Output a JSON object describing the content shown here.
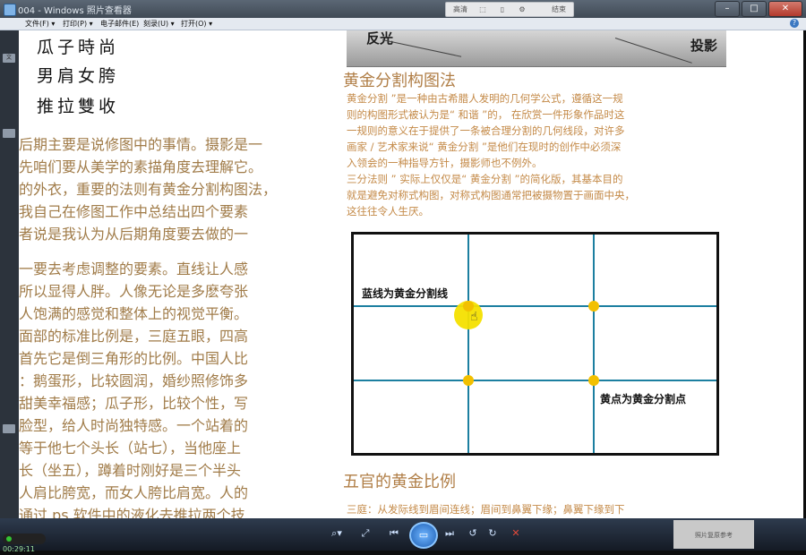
{
  "window": {
    "title": "004 - Windows 照片查看器",
    "recorder": [
      "高清",
      "结束"
    ],
    "buttons": [
      "–",
      "□",
      "✕"
    ]
  },
  "menu": {
    "items": [
      "文件(F) ▾",
      "打印(P) ▾",
      "电子邮件(E)",
      "刻录(U) ▾",
      "打开(O) ▾"
    ],
    "help_icon": "?"
  },
  "left_strip": {
    "tab_label": "文"
  },
  "timer": {
    "text": "00:29:11"
  },
  "left_page": {
    "calligraphy": [
      "瓜子時尚",
      "男肩女胯",
      "推拉雙收"
    ],
    "lines": [
      "后期主要是说修图中的事情。摄影是一",
      "先咱们要从美学的素描角度去理解它。",
      "的外衣，重要的法则有黄金分割构图法，",
      "我自己在修图工作中总结出四个要素",
      "者说是我认为从后期角度要去做的一",
      "",
      "一要去考虑调整的要素。直线让人感",
      "所以显得人胖。人像无论是多麽夸张",
      "人饱满的感觉和整体上的视觉平衡。",
      "面部的标准比例是，三庭五眼，四高",
      "首先它是倒三角形的比例。中国人比",
      "：鹅蛋形，比较圆润，婚纱照修饰多",
      "甜美幸福感；瓜子形，比较个性，写",
      "脸型，给人时尚独特感。一个站着的",
      "等于他七个头长（站七），当他座上",
      "长（坐五），蹲着时刚好是三个半头",
      "人肩比胯宽，而女人胯比肩宽。人的",
      "通过 ps 软件中的液化去推拉两个技"
    ]
  },
  "right_page": {
    "photo_labels": [
      "反光",
      "投影"
    ],
    "heading1": "黄金分割构图法",
    "para_lines": [
      "黄金分割 ”是一种由古希腊人发明的几何学公式，遵循这一规",
      "则的构图形式被认为是“ 和谐 ”的， 在欣赏一件形象作品时这",
      "一规则的意义在于提供了一条被合理分割的几何线段，对许多",
      "画家 / 艺术家来说“ 黄金分割 ”是他们在现时的创作中必须深",
      "入领会的一种指导方针，摄影师也不例外。",
      "三分法则 ” 实际上仅仅是“ 黄金分割 ”的简化版，其基本目的",
      "就是避免对称式构图，对称式构图通常把被摄物置于画面中央，",
      "这往往令人生厌。"
    ],
    "diagram_labels": {
      "blue": "蓝线为黄金分割线",
      "gold": "黄点为黄金分割点"
    },
    "heading2": "五官的黄金比例",
    "last_line": "三庭：从发际线到眉间连线；眉间到鼻翼下缘；鼻翼下缘到下"
  },
  "toolbar": {
    "icons": [
      "zoom-icon",
      "fit-icon",
      "prev-icon",
      "slideshow-icon",
      "next-icon",
      "rotate-left-icon",
      "rotate-right-icon",
      "delete-icon"
    ],
    "thumb_text": "照片复原参考"
  },
  "colors": {
    "body_text": "#a07b48",
    "heading": "#b07e46",
    "grid_line": "#1c7fa0",
    "golden_point": "#f2c000"
  }
}
